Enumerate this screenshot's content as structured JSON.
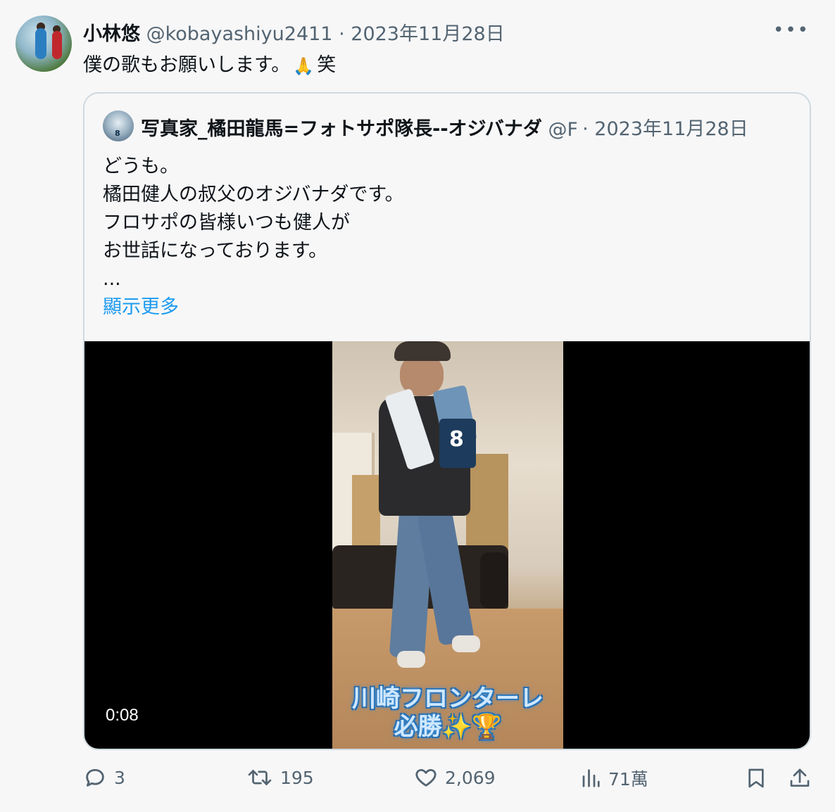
{
  "tweet": {
    "author_name": "小林悠",
    "author_handle": "@kobayashiyu2411",
    "separator": "·",
    "date": "2023年11月28日",
    "text": "僕の歌もお願いします。",
    "emoji": "🙏",
    "text_suffix": "笑"
  },
  "quote": {
    "author_name": "写真家_橘田龍馬=フォトサポ隊長--オジバナダ",
    "author_handle": "@F",
    "separator": "·",
    "date": "2023年11月28日",
    "lines": [
      "どうも。",
      "橘田健人の叔父のオジバナダです。",
      "フロサポの皆様いつも健人が",
      "お世話になっております。",
      "..."
    ],
    "show_more": "顯示更多",
    "video": {
      "timestamp": "0:08",
      "caption_line1": "川崎フロンターレ",
      "caption_line2": "必勝✨🏆",
      "jersey_number": "8"
    }
  },
  "actions": {
    "replies": "3",
    "retweets": "195",
    "likes": "2,069",
    "views": "71萬"
  },
  "icons": {
    "more": "more-horizontal-icon",
    "reply": "reply-icon",
    "retweet": "retweet-icon",
    "like": "heart-icon",
    "views": "views-icon",
    "bookmark": "bookmark-icon",
    "share": "share-icon"
  },
  "colors": {
    "link": "#1d9bf0",
    "muted": "#536471",
    "border": "#cfd9de"
  }
}
